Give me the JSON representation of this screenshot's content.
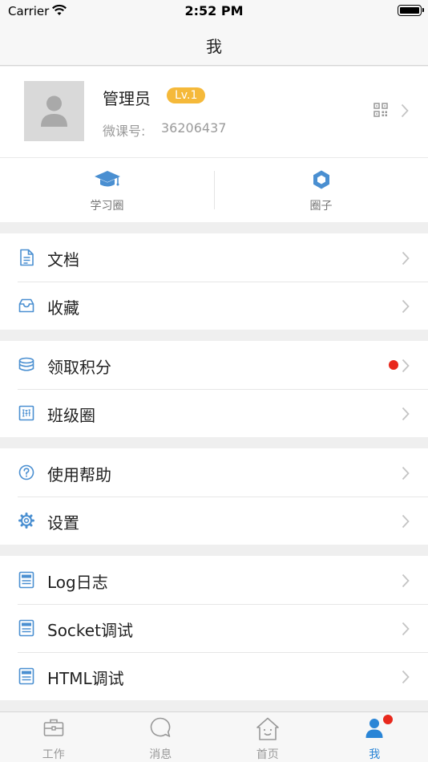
{
  "status_bar": {
    "carrier": "Carrier",
    "time": "2:52 PM"
  },
  "nav": {
    "title": "我"
  },
  "profile": {
    "name": "管理员",
    "level": "Lv.1",
    "weike_label": "微课号:",
    "weike_id": "36206437"
  },
  "quick_actions": [
    {
      "label": "学习圈",
      "icon": "graduation-cap-icon"
    },
    {
      "label": "圈子",
      "icon": "hexagon-icon"
    }
  ],
  "menu_groups": [
    {
      "items": [
        {
          "label": "文档",
          "icon": "document-icon",
          "badge": false
        },
        {
          "label": "收藏",
          "icon": "inbox-icon",
          "badge": false
        }
      ]
    },
    {
      "items": [
        {
          "label": "领取积分",
          "icon": "coins-icon",
          "badge": true
        },
        {
          "label": "班级圈",
          "icon": "class-icon",
          "badge": false
        }
      ]
    },
    {
      "items": [
        {
          "label": "使用帮助",
          "icon": "help-icon",
          "badge": false
        },
        {
          "label": "设置",
          "icon": "gear-icon",
          "badge": false
        }
      ]
    },
    {
      "items": [
        {
          "label": "Log日志",
          "icon": "log-icon",
          "badge": false
        },
        {
          "label": "Socket调试",
          "icon": "socket-icon",
          "badge": false
        },
        {
          "label": "HTML调试",
          "icon": "html-icon",
          "badge": false
        }
      ]
    }
  ],
  "tabs": [
    {
      "label": "工作",
      "icon": "briefcase-icon",
      "active": false
    },
    {
      "label": "消息",
      "icon": "message-icon",
      "active": false
    },
    {
      "label": "首页",
      "icon": "home-icon",
      "active": false
    },
    {
      "label": "我",
      "icon": "person-icon",
      "active": true,
      "badge": true
    }
  ],
  "colors": {
    "accent": "#2a85d6",
    "icon_blue": "#4a8fd1",
    "level_badge": "#f5b93a",
    "badge_dot": "#e8281c"
  }
}
